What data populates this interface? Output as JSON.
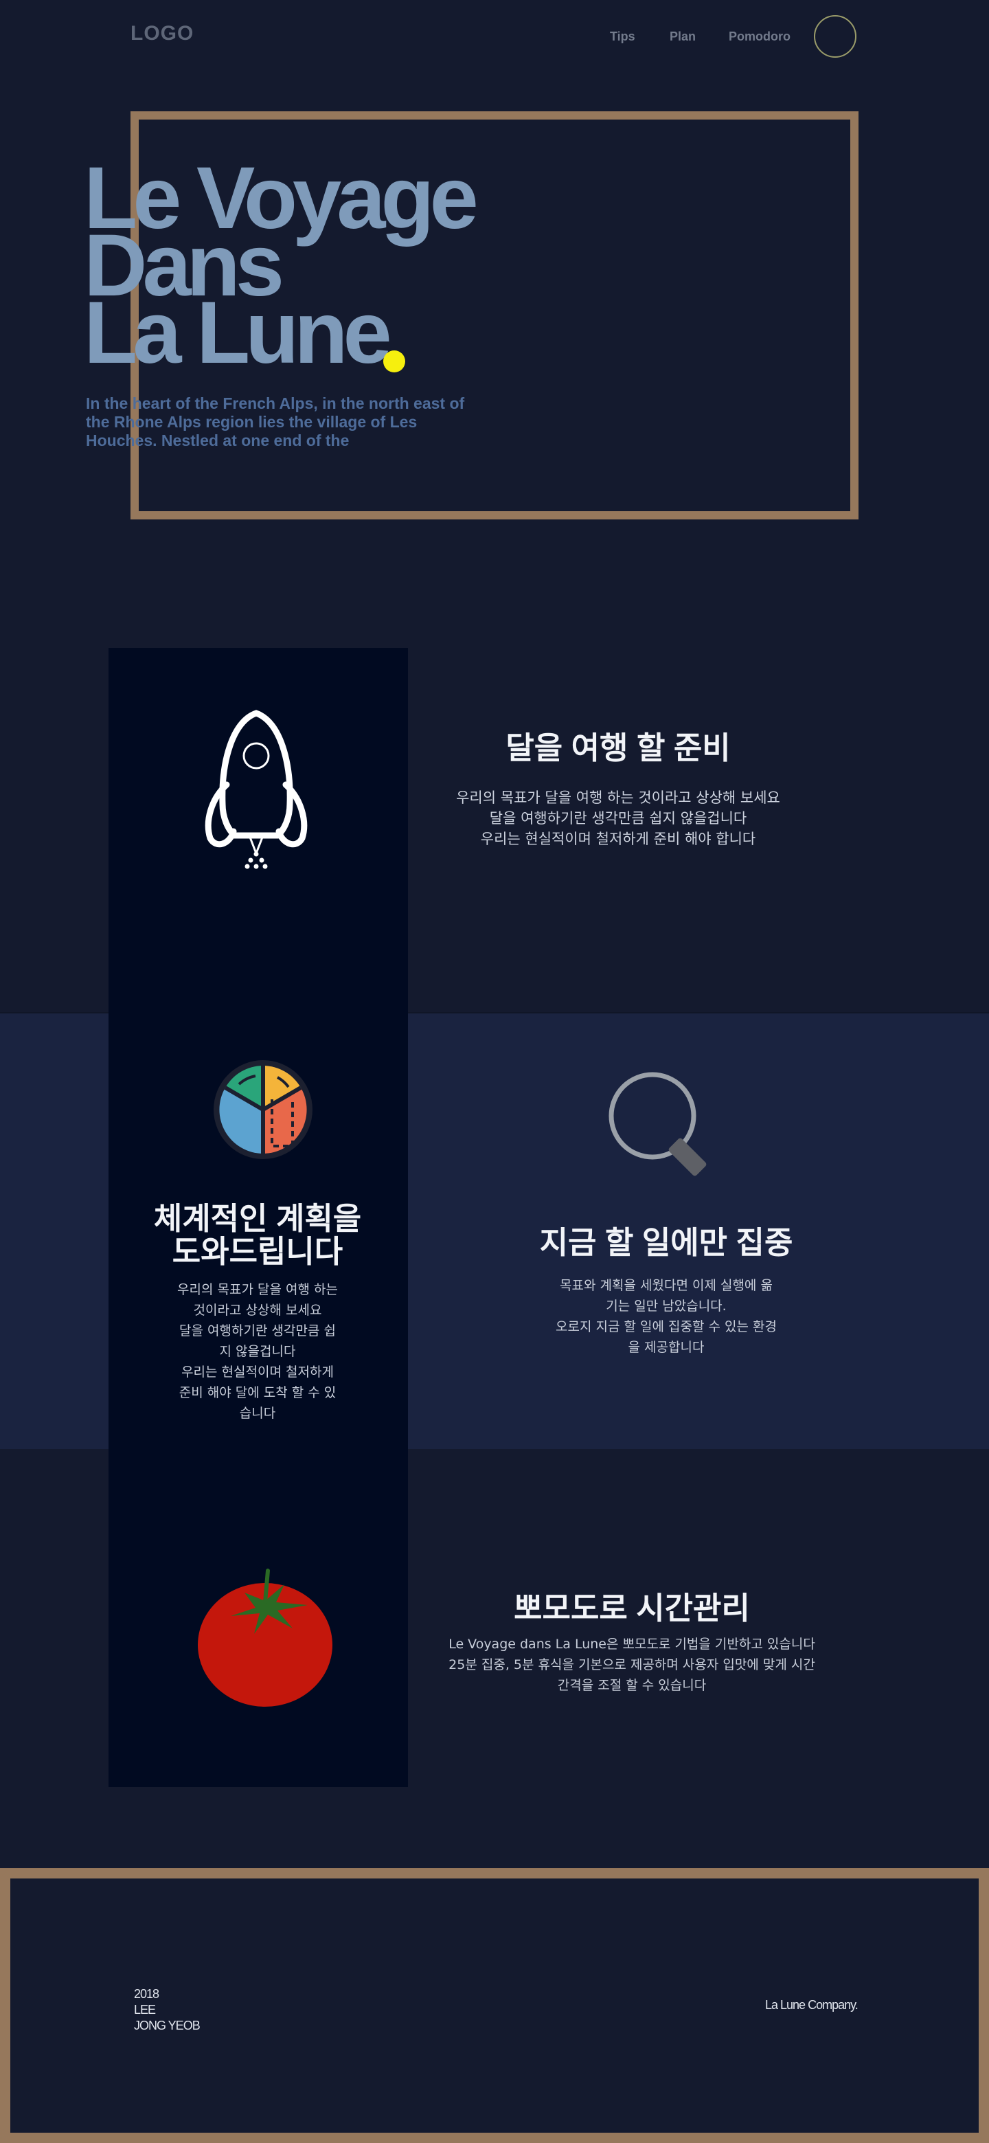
{
  "header": {
    "logo": "LOGO",
    "nav": [
      {
        "label": "Tips"
      },
      {
        "label": "Plan"
      },
      {
        "label": "Pomodoro"
      }
    ]
  },
  "hero": {
    "title_lines": [
      "Le Voyage",
      "Dans",
      "La Lune"
    ],
    "subtitle": "In the heart of the French Alps, in the north east of the Rhone Alps region lies the village of Les Houches. Nestled at one end of the"
  },
  "features": {
    "prepare": {
      "title": "달을 여행 할 준비",
      "text": "우리의 목표가 달을 여행 하는 것이라고 상상해 보세요\n달을 여행하기란 생각만큼 쉽지 않을겁니다\n우리는 현실적이며 철저하게 준비 해야 합니다"
    },
    "plan": {
      "title_lines": [
        "체계적인 계획을",
        "도와드립니다"
      ],
      "text": "우리의 목표가 달을 여행 하는\n것이라고 상상해 보세요\n달을 여행하기란 생각만큼 쉽\n지 않을겁니다\n우리는 현실적이며 철저하게\n준비 해야 달에 도착 할 수 있\n습니다"
    },
    "focus": {
      "title": "지금 할 일에만 집중",
      "text": "목표와 계획을 세웠다면 이제 실행에 옮\n기는 일만 남았습니다.\n오로지 지금 할 일에 집중할 수 있는 환경\n을 제공합니다"
    },
    "pomodoro": {
      "title": "뽀모도로 시간관리",
      "text": "Le Voyage dans La Lune은 뽀모도로 기법을 기반하고 있습니다\n25분 집중, 5분 휴식을 기본으로 제공하며 사용자 입맛에 맞게 시간\n간격을 조절 할 수 있습니다"
    }
  },
  "footer": {
    "year": "2018",
    "author_first": "LEE",
    "author_last": "JONG YEOB",
    "company": "La Lune Company."
  },
  "icons": {
    "rocket": "rocket-icon",
    "pie": "pie-chart-icon",
    "search": "magnifier-icon",
    "tomato": "tomato-icon"
  },
  "colors": {
    "background": "#141a2e",
    "frame": "#96785c",
    "title": "#7f9bba",
    "accent_dot": "#f6ef0e",
    "dark_column": "#010a21",
    "band": "#1a2340"
  }
}
